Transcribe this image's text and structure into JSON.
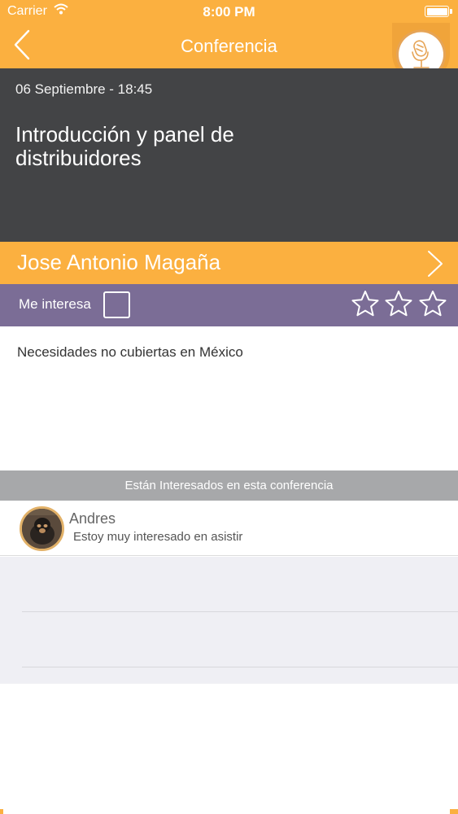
{
  "status_bar": {
    "carrier": "Carrier",
    "time": "8:00 PM"
  },
  "nav": {
    "title": "Conferencia",
    "back_icon": "chevron-left-icon",
    "badge_icon": "microphone-icon"
  },
  "event": {
    "datetime": "06 Septiembre - 18:45",
    "title": "Introducción y panel de distribuidores"
  },
  "speaker": {
    "name": "Jose Antonio Magaña"
  },
  "interest": {
    "label": "Me interesa",
    "checked": false,
    "rating_max": 3,
    "rating": 0
  },
  "description": "Necesidades no cubiertas en México",
  "attendees_section": {
    "header": "Están Interesados en esta conferencia",
    "items": [
      {
        "name": "Andres",
        "comment": "Estoy muy interesado en asistir"
      }
    ]
  },
  "colors": {
    "orange": "#FBB040",
    "dark": "#434446",
    "purple": "#7B6D96",
    "gray_header": "#A7A8AA"
  }
}
